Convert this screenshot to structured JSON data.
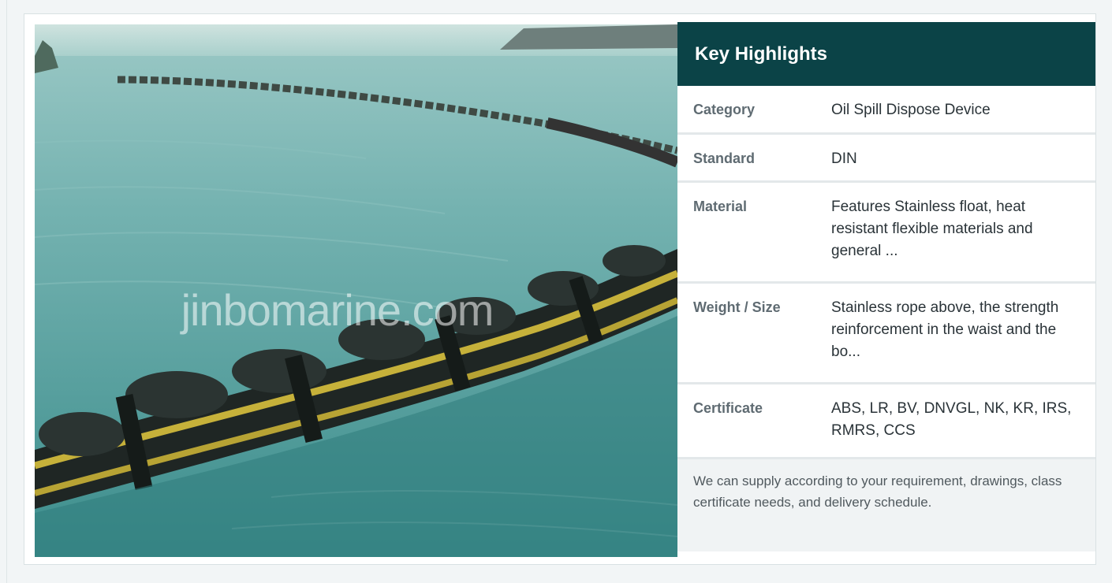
{
  "photo": {
    "watermark": "jinbomarine.com",
    "alt": "Oil spill containment boom floating on sea water"
  },
  "highlights": {
    "title": "Key Highlights",
    "rows": [
      {
        "label": "Category",
        "value": "Oil Spill Dispose Device"
      },
      {
        "label": "Standard",
        "value": "DIN"
      },
      {
        "label": "Material",
        "value": "Features Stainless float, heat resistant flexible materials and general ..."
      },
      {
        "label": "Weight / Size",
        "value": "Stainless rope above, the strength reinforcement in the waist and the bo..."
      },
      {
        "label": "Certificate",
        "value": "ABS, LR, BV, DNVGL, NK, KR, IRS, RMRS, CCS"
      }
    ],
    "note": "We can supply according to your requirement, drawings, class certificate needs, and delivery schedule."
  },
  "colors": {
    "header_bg": "#0b4347",
    "page_bg": "#f2f5f6",
    "note_bg": "#f0f3f4",
    "label_text": "#5f6b72"
  }
}
